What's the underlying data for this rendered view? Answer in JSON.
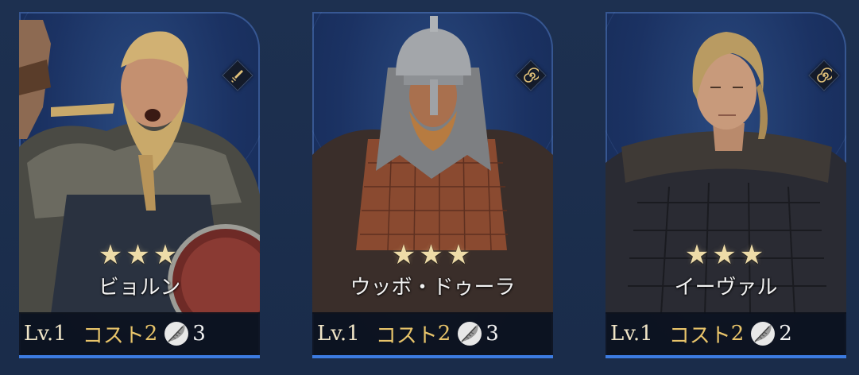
{
  "colors": {
    "background": "#1c2f4e",
    "card_bg": "#1b3263",
    "star": "#eedca8",
    "cost": "#e8c46a",
    "bottom_line": "#3c7be0"
  },
  "cards": [
    {
      "stars": "★★★",
      "name": "ビョルン",
      "level": "Lv.1",
      "cost_label": "コスト",
      "cost_value": "2",
      "unit_value": "3",
      "class_icon": "sword-icon"
    },
    {
      "stars": "★★★",
      "name": "ウッボ・ドゥーラ",
      "level": "Lv.1",
      "cost_label": "コスト",
      "cost_value": "2",
      "unit_value": "3",
      "class_icon": "spiral-icon"
    },
    {
      "stars": "★★★",
      "name": "イーヴァル",
      "level": "Lv.1",
      "cost_label": "コスト",
      "cost_value": "2",
      "unit_value": "2",
      "class_icon": "spiral-icon"
    }
  ]
}
